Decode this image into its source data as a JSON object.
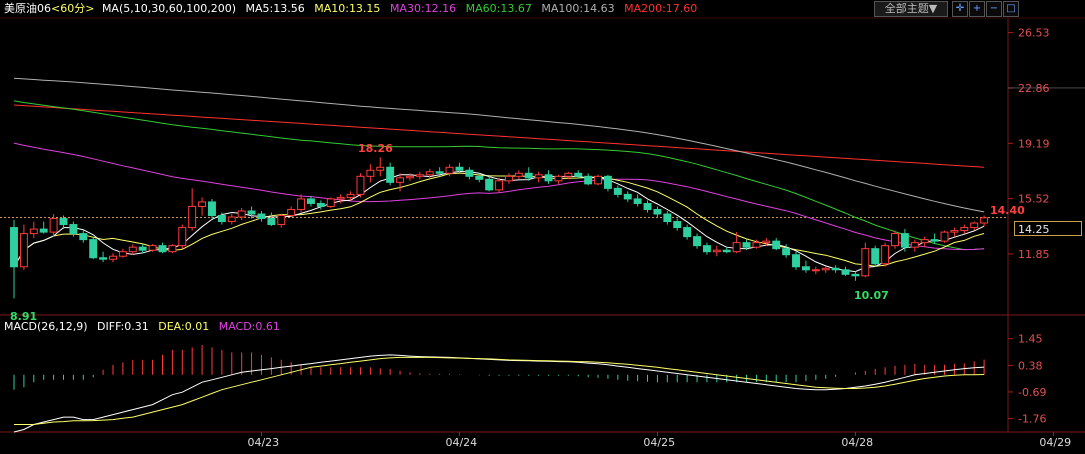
{
  "header": {
    "symbol": "美原油06",
    "period": "<60分>",
    "ma_params": "MA(5,10,30,60,100,200)",
    "ma5": "MA5:13.56",
    "ma10": "MA10:13.15",
    "ma30": "MA30:12.16",
    "ma60": "MA60:13.67",
    "ma100": "MA100:14.63",
    "ma200": "MA200:17.60",
    "theme_button": "全部主题▼"
  },
  "colors": {
    "up": "#ff3b3b",
    "down": "#2ed0a0",
    "ma5": "#ffffff",
    "ma10": "#ffff66",
    "ma30": "#e040e0",
    "ma60": "#33cc33",
    "ma100": "#b0b0b0",
    "ma200": "#ff3030",
    "grid": "#5a1010"
  },
  "price_axis": [
    "26.53",
    "22.86",
    "19.19",
    "15.52",
    "11.85"
  ],
  "macd_axis": [
    "1.45",
    "0.38",
    "-0.69",
    "-1.76"
  ],
  "last_price_box": "14.25",
  "annotations": {
    "high": "18.26",
    "low": "10.07",
    "start_low": "8.91",
    "last_high": "14.40"
  },
  "macd_header": {
    "params": "MACD(26,12,9)",
    "diff": "DIFF:0.31",
    "dea": "DEA:0.01",
    "macd": "MACD:0.61"
  },
  "chart_data": {
    "type": "candlestick",
    "y_range": [
      8.0,
      27.5
    ],
    "x_labels": [
      "04/23",
      "04/24",
      "04/25",
      "04/28",
      "04/29"
    ],
    "x_label_positions": [
      25,
      45,
      65,
      85,
      105
    ],
    "candles": [
      [
        13.6,
        14.1,
        8.9,
        11.0
      ],
      [
        11.0,
        13.8,
        10.8,
        13.2
      ],
      [
        13.2,
        14.0,
        12.9,
        13.5
      ],
      [
        13.5,
        14.0,
        13.2,
        13.3
      ],
      [
        13.3,
        14.5,
        13.0,
        14.2
      ],
      [
        14.2,
        14.4,
        13.5,
        13.8
      ],
      [
        13.8,
        14.0,
        13.0,
        13.2
      ],
      [
        13.2,
        13.4,
        12.6,
        12.8
      ],
      [
        12.8,
        13.0,
        11.5,
        11.6
      ],
      [
        11.6,
        12.0,
        11.3,
        11.5
      ],
      [
        11.5,
        11.9,
        11.3,
        11.7
      ],
      [
        11.7,
        12.2,
        11.6,
        12.0
      ],
      [
        12.0,
        12.5,
        11.8,
        12.3
      ],
      [
        12.3,
        12.5,
        11.9,
        12.1
      ],
      [
        12.1,
        12.5,
        12.0,
        12.4
      ],
      [
        12.4,
        12.6,
        11.9,
        12.0
      ],
      [
        12.0,
        12.5,
        11.9,
        12.4
      ],
      [
        12.4,
        13.8,
        12.2,
        13.6
      ],
      [
        13.6,
        16.2,
        13.4,
        15.0
      ],
      [
        15.0,
        15.6,
        14.4,
        15.3
      ],
      [
        15.3,
        15.5,
        14.2,
        14.4
      ],
      [
        14.4,
        14.6,
        13.8,
        14.0
      ],
      [
        14.0,
        14.5,
        13.8,
        14.3
      ],
      [
        14.3,
        14.9,
        14.1,
        14.7
      ],
      [
        14.7,
        15.0,
        14.2,
        14.5
      ],
      [
        14.5,
        14.7,
        14.0,
        14.2
      ],
      [
        14.2,
        14.6,
        13.7,
        13.8
      ],
      [
        13.8,
        14.5,
        13.6,
        14.4
      ],
      [
        14.4,
        15.0,
        14.3,
        14.8
      ],
      [
        14.8,
        15.8,
        14.6,
        15.5
      ],
      [
        15.5,
        15.7,
        15.0,
        15.2
      ],
      [
        15.2,
        15.4,
        14.8,
        15.0
      ],
      [
        15.0,
        15.6,
        14.9,
        15.5
      ],
      [
        15.5,
        15.8,
        15.2,
        15.6
      ],
      [
        15.6,
        16.0,
        15.4,
        15.8
      ],
      [
        15.8,
        17.2,
        15.6,
        17.0
      ],
      [
        17.0,
        17.8,
        16.6,
        17.4
      ],
      [
        17.4,
        18.26,
        17.0,
        17.6
      ],
      [
        17.6,
        17.9,
        16.4,
        16.6
      ],
      [
        16.6,
        17.2,
        16.0,
        16.9
      ],
      [
        16.9,
        17.2,
        16.7,
        17.0
      ],
      [
        17.0,
        17.3,
        16.8,
        17.1
      ],
      [
        17.1,
        17.5,
        16.9,
        17.3
      ],
      [
        17.3,
        17.6,
        17.0,
        17.2
      ],
      [
        17.2,
        17.8,
        17.0,
        17.6
      ],
      [
        17.6,
        17.9,
        17.2,
        17.4
      ],
      [
        17.4,
        17.6,
        16.8,
        17.0
      ],
      [
        17.0,
        17.2,
        16.6,
        16.8
      ],
      [
        16.8,
        17.0,
        16.0,
        16.1
      ],
      [
        16.1,
        16.9,
        15.9,
        16.7
      ],
      [
        16.7,
        17.2,
        16.5,
        17.0
      ],
      [
        17.0,
        17.4,
        16.8,
        17.2
      ],
      [
        17.2,
        17.6,
        16.7,
        16.9
      ],
      [
        16.9,
        17.3,
        16.6,
        17.1
      ],
      [
        17.1,
        17.4,
        16.5,
        16.7
      ],
      [
        16.7,
        17.1,
        16.5,
        17.0
      ],
      [
        17.0,
        17.3,
        16.8,
        17.2
      ],
      [
        17.2,
        17.4,
        16.9,
        17.0
      ],
      [
        17.0,
        17.2,
        16.4,
        16.5
      ],
      [
        16.5,
        17.1,
        16.4,
        17.0
      ],
      [
        17.0,
        17.1,
        16.0,
        16.2
      ],
      [
        16.2,
        16.4,
        15.6,
        15.8
      ],
      [
        15.8,
        16.0,
        15.3,
        15.5
      ],
      [
        15.5,
        15.8,
        15.0,
        15.2
      ],
      [
        15.2,
        15.4,
        14.6,
        14.8
      ],
      [
        14.8,
        15.0,
        14.3,
        14.5
      ],
      [
        14.5,
        14.7,
        13.8,
        14.0
      ],
      [
        14.0,
        14.2,
        13.4,
        13.6
      ],
      [
        13.6,
        13.8,
        12.8,
        13.0
      ],
      [
        13.0,
        13.2,
        12.2,
        12.4
      ],
      [
        12.4,
        12.6,
        11.8,
        12.0
      ],
      [
        12.0,
        12.4,
        11.7,
        12.1
      ],
      [
        12.1,
        12.3,
        11.9,
        12.0
      ],
      [
        12.0,
        13.3,
        11.9,
        12.6
      ],
      [
        12.6,
        12.8,
        12.1,
        12.3
      ],
      [
        12.3,
        12.8,
        12.2,
        12.6
      ],
      [
        12.6,
        12.9,
        12.4,
        12.7
      ],
      [
        12.7,
        12.9,
        12.1,
        12.2
      ],
      [
        12.2,
        12.5,
        11.6,
        11.8
      ],
      [
        11.8,
        12.0,
        10.8,
        11.0
      ],
      [
        11.0,
        11.4,
        10.6,
        10.8
      ],
      [
        10.8,
        11.0,
        10.5,
        10.8
      ],
      [
        10.8,
        11.0,
        10.6,
        10.9
      ],
      [
        10.9,
        11.1,
        10.6,
        10.8
      ],
      [
        10.8,
        11.0,
        10.4,
        10.5
      ],
      [
        10.5,
        10.7,
        10.07,
        10.4
      ],
      [
        10.4,
        12.6,
        10.3,
        12.2
      ],
      [
        12.2,
        12.4,
        11.0,
        11.2
      ],
      [
        11.2,
        12.6,
        11.0,
        12.4
      ],
      [
        12.4,
        13.4,
        12.2,
        13.2
      ],
      [
        13.2,
        13.5,
        12.0,
        12.3
      ],
      [
        12.3,
        12.8,
        12.0,
        12.6
      ],
      [
        12.6,
        13.0,
        12.3,
        12.8
      ],
      [
        12.8,
        13.2,
        12.5,
        12.7
      ],
      [
        12.7,
        13.4,
        12.6,
        13.3
      ],
      [
        13.3,
        13.6,
        13.0,
        13.4
      ],
      [
        13.4,
        13.8,
        13.2,
        13.6
      ],
      [
        13.6,
        14.0,
        13.4,
        13.9
      ],
      [
        13.9,
        14.4,
        13.7,
        14.25
      ]
    ],
    "macd_y_range": [
      -2.3,
      1.8
    ],
    "diff": [
      -2.3,
      -2.2,
      -2.0,
      -1.9,
      -1.8,
      -1.7,
      -1.7,
      -1.8,
      -1.8,
      -1.7,
      -1.6,
      -1.5,
      -1.4,
      -1.3,
      -1.2,
      -1.0,
      -0.8,
      -0.7,
      -0.5,
      -0.3,
      -0.2,
      -0.1,
      0.0,
      0.1,
      0.15,
      0.2,
      0.25,
      0.3,
      0.35,
      0.4,
      0.45,
      0.5,
      0.55,
      0.6,
      0.65,
      0.7,
      0.75,
      0.78,
      0.8,
      0.78,
      0.75,
      0.73,
      0.72,
      0.71,
      0.7,
      0.68,
      0.66,
      0.64,
      0.62,
      0.6,
      0.58,
      0.57,
      0.56,
      0.55,
      0.54,
      0.53,
      0.52,
      0.5,
      0.47,
      0.44,
      0.4,
      0.35,
      0.3,
      0.25,
      0.2,
      0.15,
      0.1,
      0.05,
      0.0,
      -0.05,
      -0.1,
      -0.15,
      -0.2,
      -0.25,
      -0.3,
      -0.35,
      -0.4,
      -0.45,
      -0.5,
      -0.55,
      -0.58,
      -0.6,
      -0.6,
      -0.58,
      -0.55,
      -0.5,
      -0.45,
      -0.38,
      -0.3,
      -0.2,
      -0.1,
      0.0,
      0.05,
      0.1,
      0.15,
      0.2,
      0.25,
      0.28,
      0.31
    ],
    "dea": [
      -2.0,
      -2.0,
      -2.0,
      -1.95,
      -1.9,
      -1.88,
      -1.85,
      -1.85,
      -1.84,
      -1.82,
      -1.8,
      -1.75,
      -1.7,
      -1.6,
      -1.5,
      -1.4,
      -1.3,
      -1.2,
      -1.05,
      -0.9,
      -0.75,
      -0.6,
      -0.5,
      -0.4,
      -0.3,
      -0.2,
      -0.1,
      0.0,
      0.1,
      0.2,
      0.3,
      0.35,
      0.4,
      0.45,
      0.5,
      0.55,
      0.6,
      0.65,
      0.68,
      0.7,
      0.7,
      0.7,
      0.7,
      0.69,
      0.68,
      0.67,
      0.66,
      0.65,
      0.64,
      0.62,
      0.6,
      0.59,
      0.58,
      0.57,
      0.56,
      0.55,
      0.54,
      0.53,
      0.52,
      0.5,
      0.48,
      0.45,
      0.42,
      0.38,
      0.34,
      0.3,
      0.25,
      0.2,
      0.15,
      0.1,
      0.05,
      0.0,
      -0.05,
      -0.1,
      -0.15,
      -0.2,
      -0.25,
      -0.3,
      -0.35,
      -0.4,
      -0.45,
      -0.5,
      -0.52,
      -0.54,
      -0.55,
      -0.55,
      -0.53,
      -0.5,
      -0.45,
      -0.38,
      -0.3,
      -0.22,
      -0.15,
      -0.1,
      -0.05,
      -0.02,
      0.0,
      0.005,
      0.01
    ],
    "macd_hist": [
      -0.6,
      -0.5,
      -0.3,
      -0.2,
      -0.2,
      -0.2,
      -0.2,
      -0.2,
      -0.1,
      0.2,
      0.4,
      0.5,
      0.6,
      0.6,
      0.6,
      0.8,
      1.0,
      1.0,
      1.1,
      1.2,
      1.1,
      1.0,
      0.9,
      0.9,
      0.9,
      0.8,
      0.7,
      0.6,
      0.5,
      0.4,
      0.3,
      0.3,
      0.3,
      0.3,
      0.3,
      0.3,
      0.3,
      0.26,
      0.24,
      0.16,
      0.1,
      0.06,
      0.04,
      0.04,
      0.04,
      0.02,
      0.0,
      -0.02,
      -0.04,
      -0.04,
      -0.04,
      -0.04,
      -0.04,
      -0.04,
      -0.04,
      -0.04,
      -0.04,
      -0.06,
      -0.1,
      -0.12,
      -0.16,
      -0.2,
      -0.24,
      -0.26,
      -0.28,
      -0.3,
      -0.3,
      -0.3,
      -0.3,
      -0.3,
      -0.3,
      -0.3,
      -0.3,
      -0.3,
      -0.3,
      -0.3,
      -0.3,
      -0.3,
      -0.3,
      -0.3,
      -0.26,
      -0.2,
      -0.16,
      -0.08,
      0.0,
      0.1,
      0.16,
      0.24,
      0.3,
      0.36,
      0.4,
      0.44,
      0.4,
      0.4,
      0.4,
      0.44,
      0.46,
      0.54,
      0.61
    ]
  }
}
